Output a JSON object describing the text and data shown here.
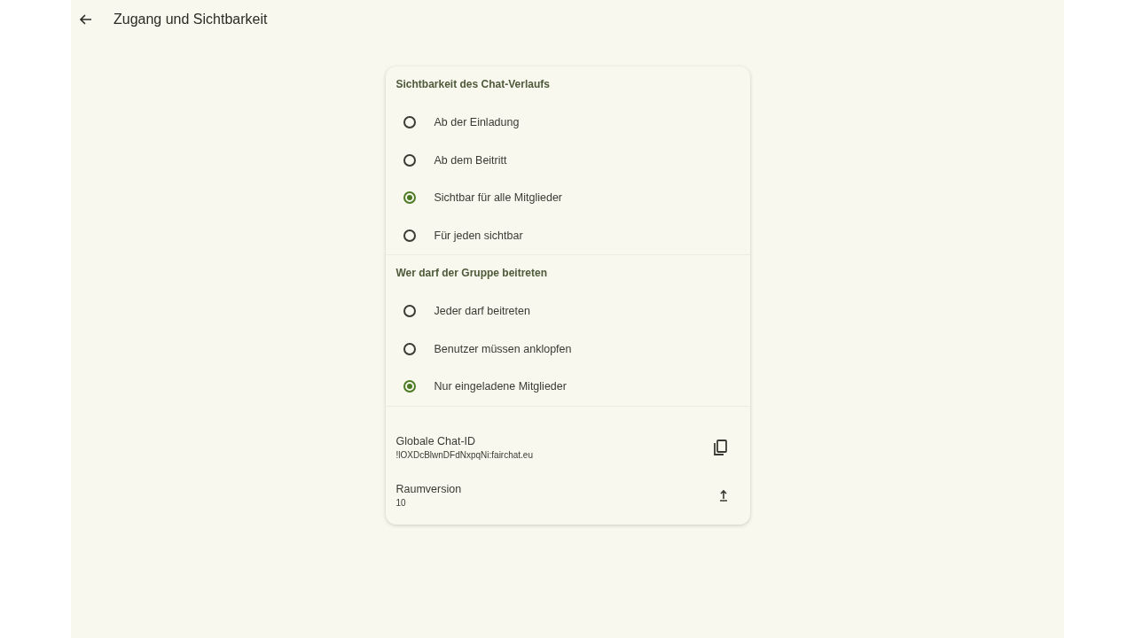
{
  "app_bar": {
    "title": "Zugang und Sichtbarkeit"
  },
  "sections": [
    {
      "title": "Sichtbarkeit des Chat-Verlaufs",
      "options": [
        {
          "label": "Ab der Einladung",
          "selected": false
        },
        {
          "label": "Ab dem Beitritt",
          "selected": false
        },
        {
          "label": "Sichtbar für alle Mitglieder",
          "selected": true
        },
        {
          "label": "Für jeden sichtbar",
          "selected": false
        }
      ]
    },
    {
      "title": "Wer darf der Gruppe beitreten",
      "options": [
        {
          "label": "Jeder darf beitreten",
          "selected": false
        },
        {
          "label": "Benutzer müssen anklopfen",
          "selected": false
        },
        {
          "label": "Nur eingeladene Mitglieder",
          "selected": true
        }
      ]
    }
  ],
  "info_rows": [
    {
      "label": "Globale Chat-ID",
      "value": "!lOXDcBlwnDFdNxpqNi:fairchat.eu",
      "kind": "copy"
    },
    {
      "label": "Raumversion",
      "value": "10",
      "kind": "upgrade"
    }
  ]
}
